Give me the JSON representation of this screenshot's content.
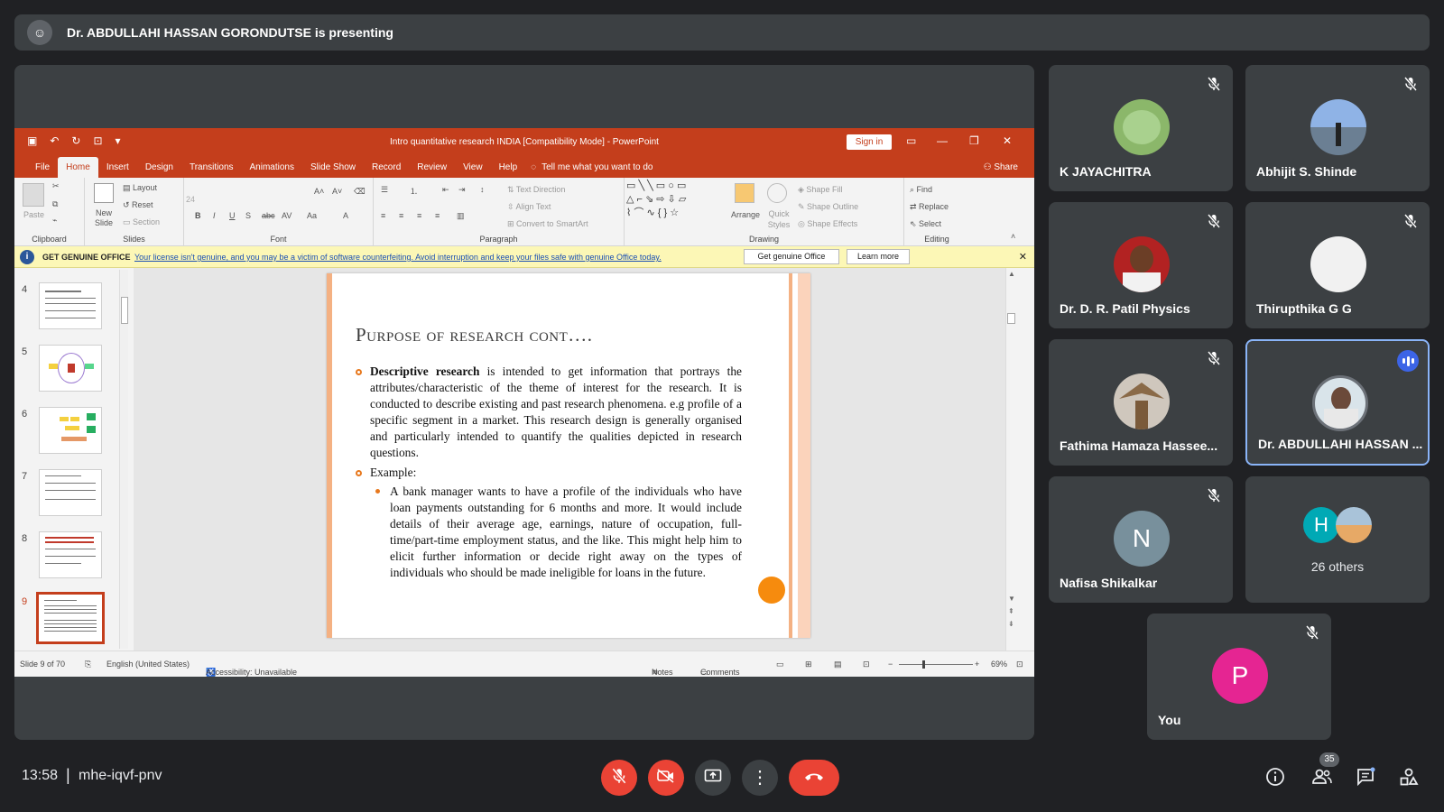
{
  "presenting": {
    "text": "Dr. ABDULLAHI HASSAN GORONDUTSE is presenting"
  },
  "ppt": {
    "window_title": "Intro quantitative research INDIA [Compatibility Mode]  -  PowerPoint",
    "sign_in": "Sign in",
    "menu": [
      "File",
      "Home",
      "Insert",
      "Design",
      "Transitions",
      "Animations",
      "Slide Show",
      "Record",
      "Review",
      "View",
      "Help"
    ],
    "tell_me": "Tell me what you want to do",
    "share": "Share",
    "ribbon": {
      "paste": "Paste",
      "new_slide": "New Slide",
      "layout": "Layout",
      "reset": "Reset",
      "section": "Section",
      "font_size": "24",
      "text_direction": "Text Direction",
      "align_text": "Align Text",
      "convert_smartart": "Convert to SmartArt",
      "arrange": "Arrange",
      "quick_styles": "Quick Styles",
      "shape_fill": "Shape Fill",
      "shape_outline": "Shape Outline",
      "shape_effects": "Shape Effects",
      "find": "Find",
      "replace": "Replace",
      "select": "Select",
      "groups": {
        "clipboard": "Clipboard",
        "slides": "Slides",
        "font": "Font",
        "paragraph": "Paragraph",
        "drawing": "Drawing",
        "editing": "Editing"
      }
    },
    "notice": {
      "label": "GET GENUINE OFFICE",
      "message": "Your license isn't genuine, and you may be a victim of software counterfeiting. Avoid interruption and keep your files safe with genuine Office today.",
      "btn1": "Get genuine Office",
      "btn2": "Learn more"
    },
    "thumbs": [
      "4",
      "5",
      "6",
      "7",
      "8",
      "9"
    ],
    "slide": {
      "title": "Purpose of research cont….",
      "bullet1_bold": "Descriptive research",
      "bullet1_rest": " is intended to get information that portrays the attributes/characteristic of the theme of interest for the research. It is conducted to describe existing and past research phenomena. e.g profile of a specific segment in a market. This research design is generally organised and particularly intended to quantify the qualities depicted in research questions.",
      "bullet2": "Example:",
      "sub1": "A bank manager wants to have a profile of the individuals who have loan payments outstanding for 6 months and more. It would include details of their average age, earnings, nature of occupation, full-time/part-time employment status, and the like. This might help him to elicit further information or decide right away on the types of individuals who should be made ineligible for loans in the future."
    },
    "status": {
      "slide_of": "Slide 9 of 70",
      "language": "English (United States)",
      "accessibility": "Accessibility: Unavailable",
      "notes": "Notes",
      "comments": "Comments",
      "zoom": "69%"
    }
  },
  "participants": [
    {
      "name": "K JAYACHITRA"
    },
    {
      "name": "Abhijit S. Shinde"
    },
    {
      "name": "Dr. D. R. Patil Physics"
    },
    {
      "name": "Thirupthika G G"
    },
    {
      "name": "Fathima Hamaza Hassee..."
    },
    {
      "name": "Dr. ABDULLAHI HASSAN ..."
    },
    {
      "name": "Nafisa Shikalkar",
      "initial": "N"
    },
    {
      "name": "26 others",
      "initial": "H"
    },
    {
      "name": "You",
      "initial": "P"
    }
  ],
  "footer": {
    "time": "13:58",
    "separator": "|",
    "code": "mhe-iqvf-pnv",
    "people_count": "35"
  },
  "colors": {
    "accent_red": "#ea4335",
    "ppt_red": "#c43e1c",
    "speaker_blue": "#8ab4f8"
  }
}
